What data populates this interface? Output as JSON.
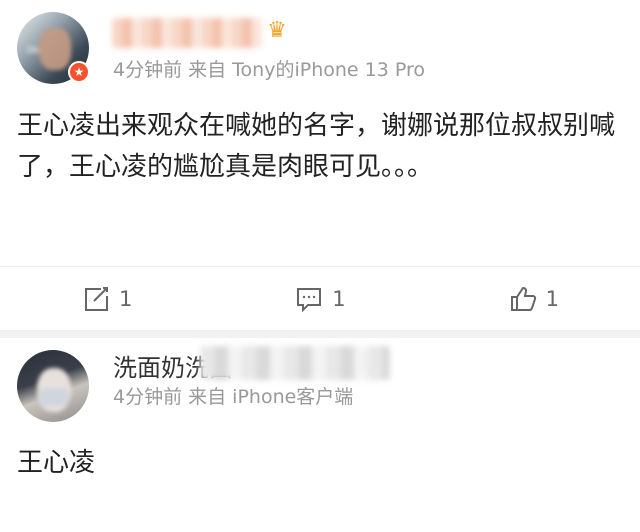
{
  "posts": [
    {
      "time_source": "4分钟前  来自 Tony的iPhone 13 Pro",
      "content": "王心凌出来观众在喊她的名字，谢娜说那位叔叔别喊了，王心凌的尴尬真是肉眼可见。。。",
      "actions": {
        "share_count": "1",
        "comment_count": "1",
        "like_count": "1"
      },
      "avatar_icon": "avatar-photo",
      "badge_icon": "verified-badge-icon"
    },
    {
      "username_visible": "洗面奶洗面",
      "time_source": "4分钟前  来自 iPhone客户端",
      "content": "王心凌",
      "avatar_icon": "avatar-photo"
    }
  ],
  "colors": {
    "badge": "#f4512c",
    "crown": "#f0a12a",
    "meta_text": "#999999",
    "separator": "#f2f2f2"
  }
}
